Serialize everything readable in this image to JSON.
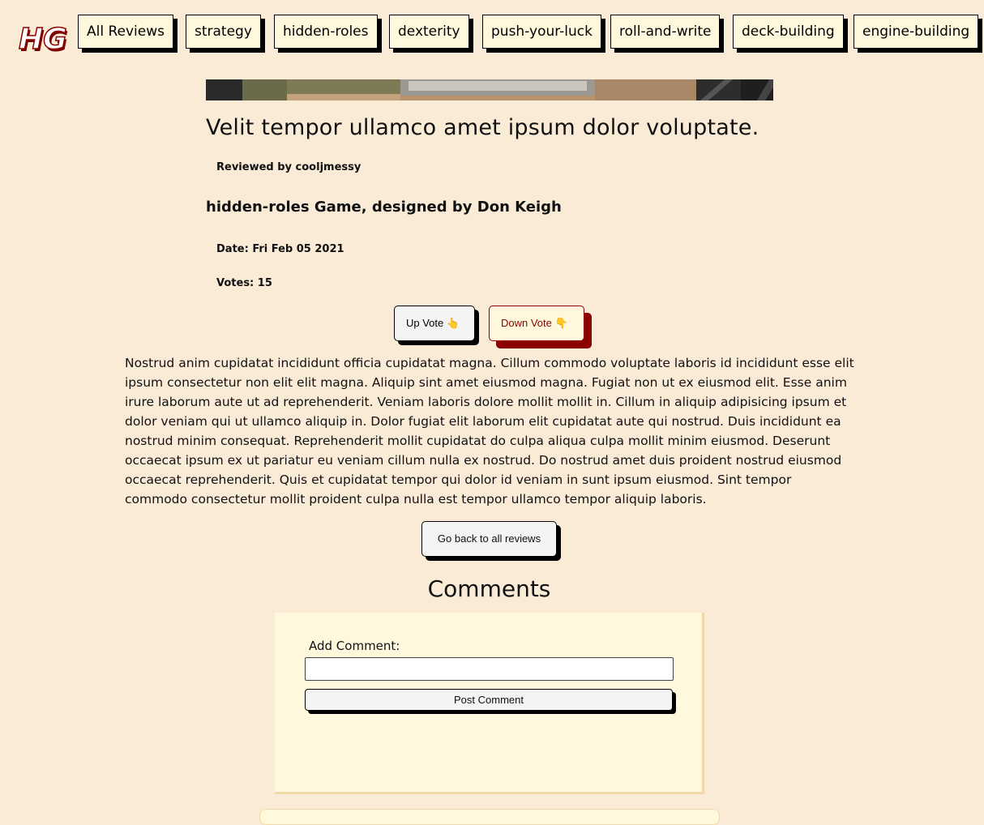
{
  "nav": {
    "logo_text": "HG",
    "items": [
      {
        "label": "All Reviews"
      },
      {
        "label": "strategy"
      },
      {
        "label": "hidden-roles"
      },
      {
        "label": "dexterity"
      },
      {
        "label": "push-your-luck"
      },
      {
        "label": "roll-and-write"
      },
      {
        "label": "deck-building"
      },
      {
        "label": "engine-building"
      }
    ]
  },
  "review": {
    "title": "Velit tempor ullamco amet ipsum dolor voluptate.",
    "reviewer": "Reviewed by cooljmessy",
    "subtitle": "hidden-roles Game, designed by Don Keigh",
    "date": "Date: Fri Feb 05 2021",
    "votes": "Votes: 15",
    "up_vote_label": "Up Vote 👆",
    "down_vote_label": "Down Vote 👇",
    "body": "Nostrud anim cupidatat incididunt officia cupidatat magna. Cillum commodo voluptate laboris id incididunt esse elit ipsum consectetur non elit elit magna. Aliquip sint amet eiusmod magna. Fugiat non ut ex eiusmod elit. Esse anim irure laborum aute ut ad reprehenderit. Veniam laboris dolore mollit mollit in. Cillum in aliquip adipisicing ipsum et dolor veniam qui ut ullamco aliquip in. Dolor fugiat elit laborum elit cupidatat aute qui nostrud. Duis incididunt ea nostrud minim consequat. Reprehenderit mollit cupidatat do culpa aliqua culpa mollit minim eiusmod. Deserunt occaecat ipsum ex ut pariatur eu veniam cillum nulla ex nostrud. Do nostrud amet duis proident nostrud eiusmod occaecat reprehenderit. Quis et cupidatat tempor qui dolor id veniam in sunt ipsum eiusmod. Sint tempor commodo consectetur mollit proident culpa nulla est tempor ullamco tempor aliquip laboris.",
    "back_label": "Go back to all reviews"
  },
  "comments": {
    "heading": "Comments",
    "add_label": "Add Comment:",
    "input_value": "",
    "input_placeholder": "",
    "post_label": "Post Comment"
  },
  "colors": {
    "page_bg": "#faebd7",
    "button_bg": "#fff8dc",
    "accent_red": "#8b0000"
  }
}
